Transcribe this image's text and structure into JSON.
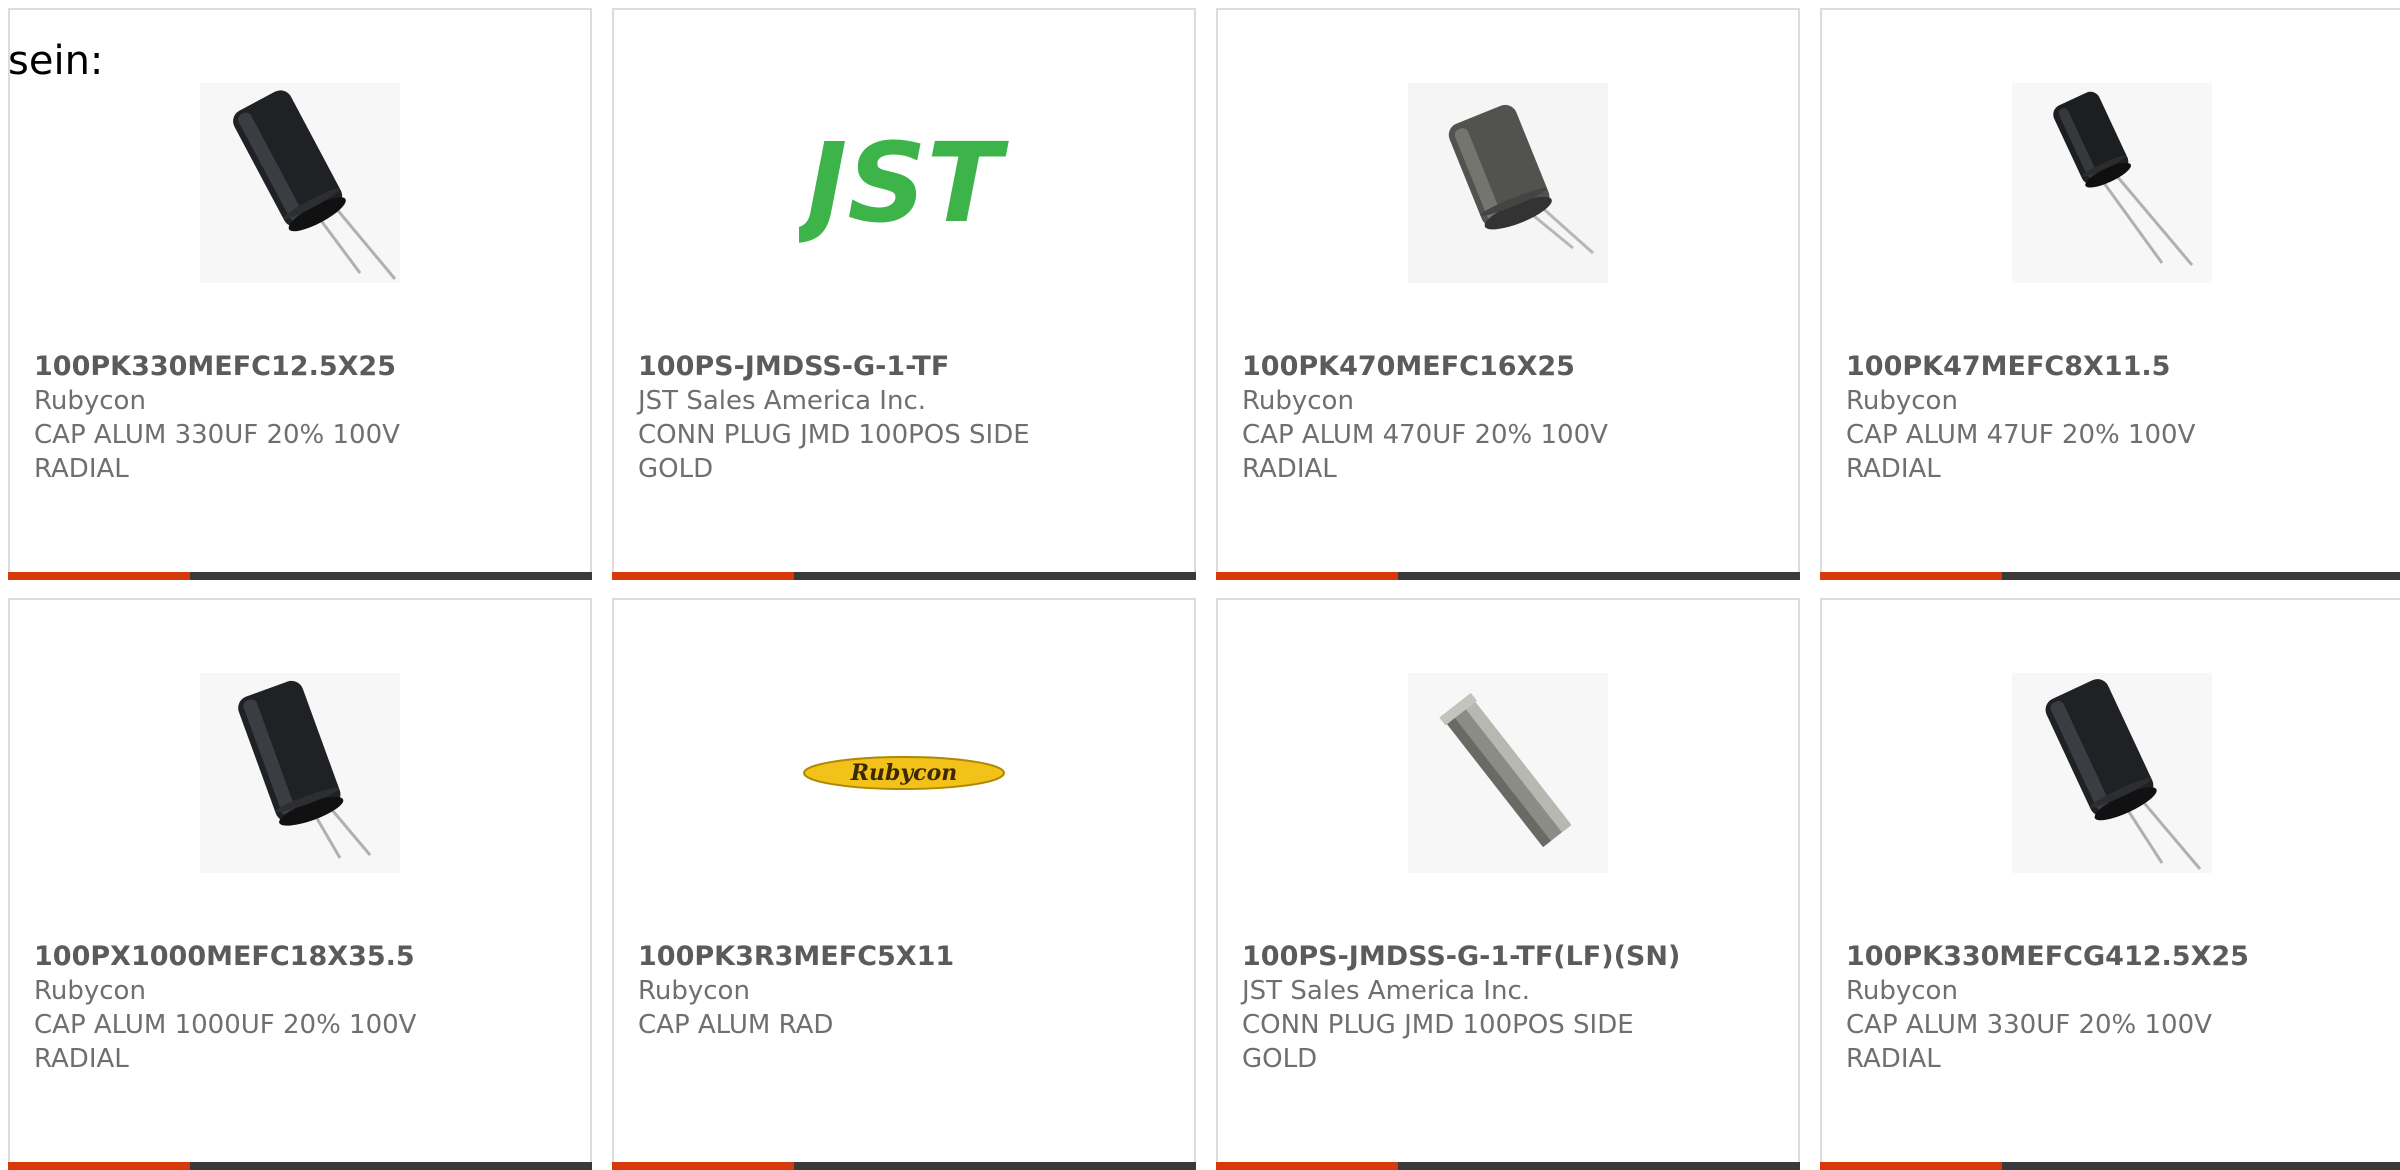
{
  "intro_text": "sein:",
  "colors": {
    "accent": "#d8390b",
    "bar": "#3a3a3a",
    "text": "#6f6f6f",
    "jst_green": "#3cb44a",
    "rubycon_yellow": "#f2c21b"
  },
  "products": [
    {
      "part_number": "100PK330MEFC12.5X25",
      "manufacturer": "Rubycon",
      "description": "CAP ALUM 330UF 20% 100V RADIAL",
      "image": "capacitor-image"
    },
    {
      "part_number": "100PS-JMDSS-G-1-TF",
      "manufacturer": "JST Sales America Inc.",
      "description": "CONN PLUG JMD 100POS SIDE GOLD",
      "image": "jst-logo",
      "logo_text": "JST"
    },
    {
      "part_number": "100PK470MEFC16X25",
      "manufacturer": "Rubycon",
      "description": "CAP ALUM 470UF 20% 100V RADIAL",
      "image": "capacitor-image"
    },
    {
      "part_number": "100PK47MEFC8X11.5",
      "manufacturer": "Rubycon",
      "description": "CAP ALUM 47UF 20% 100V RADIAL",
      "image": "capacitor-image"
    },
    {
      "part_number": "100PX1000MEFC18X35.5",
      "manufacturer": "Rubycon",
      "description": "CAP ALUM 1000UF 20% 100V RADIAL",
      "image": "capacitor-image"
    },
    {
      "part_number": "100PK3R3MEFC5X11",
      "manufacturer": "Rubycon",
      "description": "CAP ALUM RAD",
      "image": "rubycon-logo",
      "logo_text": "Rubycon"
    },
    {
      "part_number": "100PS-JMDSS-G-1-TF(LF)(SN)",
      "manufacturer": "JST Sales America Inc.",
      "description": "CONN PLUG JMD 100POS SIDE GOLD",
      "image": "connector-image"
    },
    {
      "part_number": "100PK330MEFCG412.5X25",
      "manufacturer": "Rubycon",
      "description": "CAP ALUM 330UF 20% 100V RADIAL",
      "image": "capacitor-image"
    }
  ]
}
